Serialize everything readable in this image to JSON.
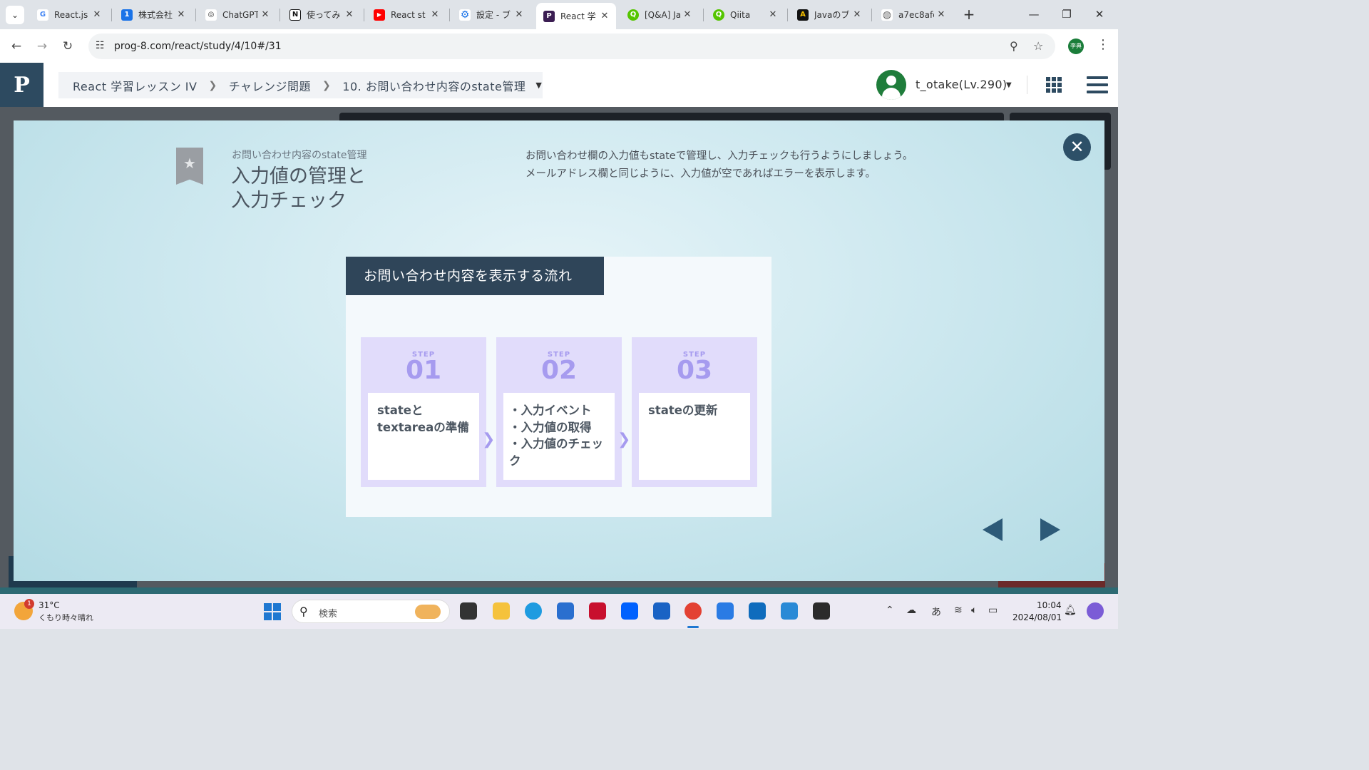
{
  "browser": {
    "tabs": [
      {
        "title": "React.js",
        "favicon": "google-icon",
        "color": "#4285f4",
        "glyph": "G"
      },
      {
        "title": "株式会社",
        "favicon": "calendar-icon",
        "color": "#1a73e8",
        "glyph": "1"
      },
      {
        "title": "ChatGPT",
        "favicon": "chatgpt-icon",
        "color": "#333333",
        "glyph": "◎"
      },
      {
        "title": "使ってみ",
        "favicon": "notion-icon",
        "color": "#111111",
        "glyph": "N"
      },
      {
        "title": "React st",
        "favicon": "youtube-icon",
        "color": "#ff0000",
        "glyph": "▶"
      },
      {
        "title": "設定 - ブ",
        "favicon": "settings-gear-icon",
        "color": "#1a73e8",
        "glyph": "⚙"
      },
      {
        "title": "React 学",
        "favicon": "prog8-icon",
        "color": "#3b1d52",
        "glyph": "P",
        "active": true
      },
      {
        "title": "[Q&A] Ja",
        "favicon": "qiita-icon",
        "color": "#55c500",
        "glyph": "Q"
      },
      {
        "title": "Qiita",
        "favicon": "qiita-icon",
        "color": "#55c500",
        "glyph": "Q"
      },
      {
        "title": "Javaのブ",
        "favicon": "a-logo-icon",
        "color": "#111111",
        "glyph": "A"
      },
      {
        "title": "a7ec8afe",
        "favicon": "globe-icon",
        "color": "#666666",
        "glyph": "◍"
      }
    ],
    "url": "prog-8.com/react/study/4/10#/31"
  },
  "header": {
    "logo": "P",
    "breadcrumb": [
      "React 学習レッスン IV",
      "チャレンジ問題",
      "10. お問い合わせ内容のstate管理"
    ],
    "username": "t_otake(Lv.290)"
  },
  "modal": {
    "subtitle": "お問い合わせ内容のstate管理",
    "title_line1": "入力値の管理と",
    "title_line2": "入力チェック",
    "desc_line1": "お問い合わせ欄の入力値もstateで管理し、入力チェックも行うようにしましょう。",
    "desc_line2": "メールアドレス欄と同じように、入力値が空であればエラーを表示します。",
    "slide_heading": "お問い合わせ内容を表示する流れ",
    "steps": [
      {
        "label": "STEP",
        "num": "01",
        "text": "stateと\ntextareaの準備"
      },
      {
        "label": "STEP",
        "num": "02",
        "text": "・入力イベント\n・入力値の取得\n・入力値のチェック"
      },
      {
        "label": "STEP",
        "num": "03",
        "text": "stateの更新"
      }
    ]
  },
  "taskbar": {
    "weather_temp": "31°C",
    "weather_desc": "くもり時々晴れ",
    "weather_badge": "1",
    "search_placeholder": "検索",
    "ime": "あ",
    "time": "10:04",
    "date": "2024/08/01"
  },
  "colors": {
    "brand": "#2d4a60",
    "step_accent": "#a69bef",
    "step_bg": "#e1dcfb",
    "slide_header": "#2f4559"
  }
}
